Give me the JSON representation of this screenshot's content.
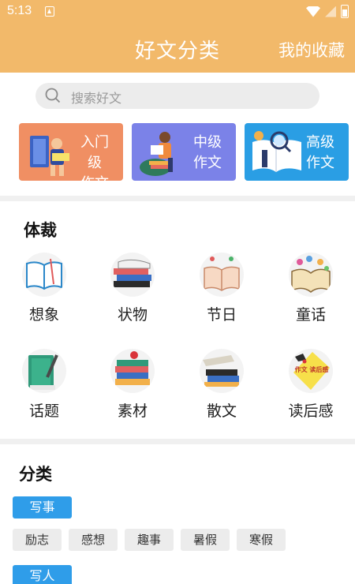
{
  "status_bar": {
    "time": "5:13"
  },
  "header": {
    "title": "好文分类",
    "favorites": "我的收藏"
  },
  "search": {
    "placeholder": "搜索好文"
  },
  "levels": [
    {
      "line1": "入门级",
      "line2": "作文",
      "color": "#f08f63"
    },
    {
      "line1": "中级",
      "line2": "作文",
      "color": "#7b82e8"
    },
    {
      "line1": "高级",
      "line2": "作文",
      "color": "#2a9ee4"
    }
  ],
  "genres": {
    "title": "体裁",
    "items": [
      {
        "name": "想象",
        "icon": "open-book-icon"
      },
      {
        "name": "状物",
        "icon": "book-stack-icon"
      },
      {
        "name": "节日",
        "icon": "book-and-lamp-icon"
      },
      {
        "name": "童话",
        "icon": "fairy-tale-book-icon"
      },
      {
        "name": "话题",
        "icon": "notebook-pen-icon"
      },
      {
        "name": "素材",
        "icon": "books-apple-icon"
      },
      {
        "name": "散文",
        "icon": "scattered-books-icon"
      },
      {
        "name": "读后感",
        "icon": "reading-note-icon",
        "badge": "作文 读后感"
      }
    ]
  },
  "categories": {
    "title": "分类",
    "groups": [
      {
        "label": "写事",
        "tags": [
          "励志",
          "感想",
          "趣事",
          "暑假",
          "寒假"
        ]
      },
      {
        "label": "写人",
        "tags": []
      }
    ]
  },
  "colors": {
    "header": "#f2b96a",
    "accent": "#2f9de9"
  }
}
